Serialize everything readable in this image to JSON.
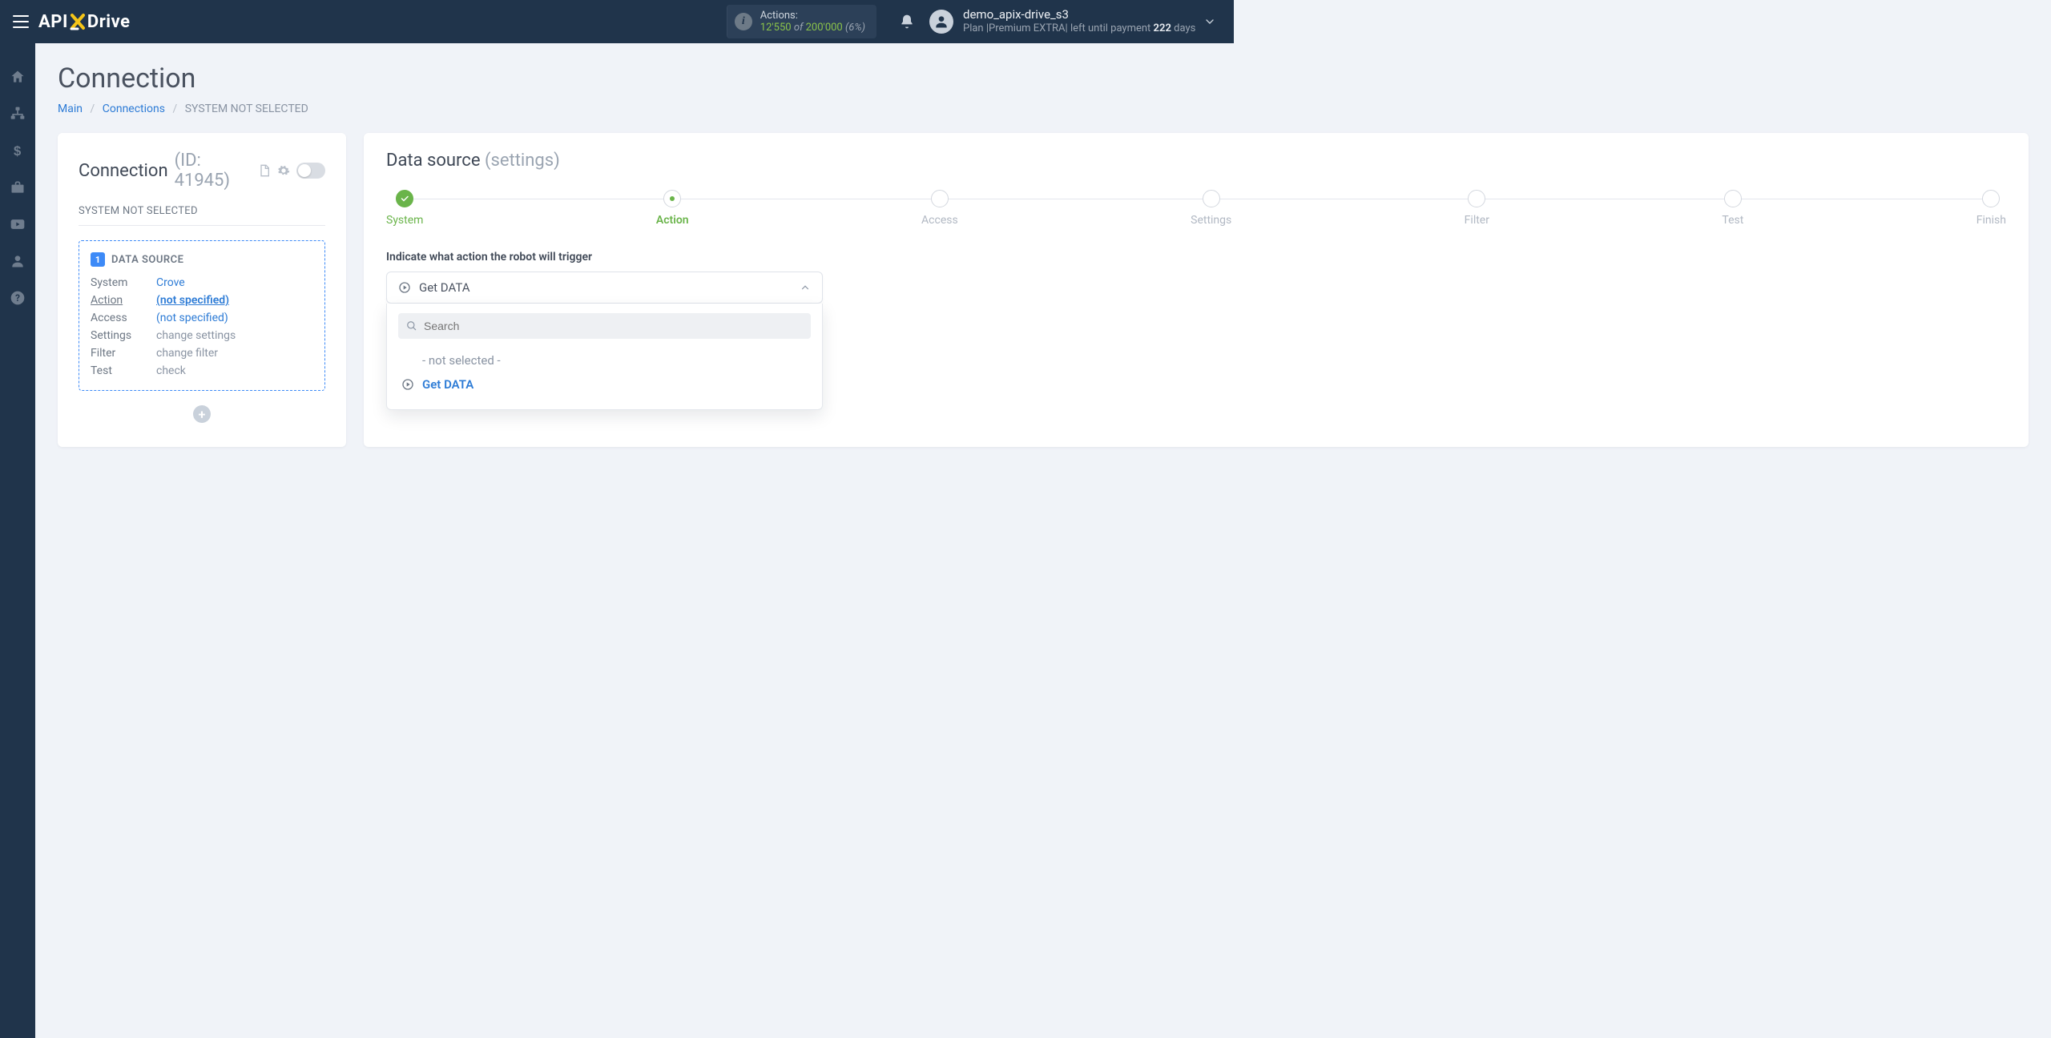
{
  "header": {
    "brand_api": "API",
    "brand_x": "X",
    "brand_drive": "Drive",
    "actions_label": "Actions:",
    "actions_count": "12'550",
    "actions_of": "of",
    "actions_total": "200'000",
    "actions_pct": "(6%)",
    "username": "demo_apix-drive_s3",
    "plan_prefix": "Plan |",
    "plan_name": "Premium EXTRA",
    "plan_suffix1": "| left until payment ",
    "plan_days": "222",
    "plan_suffix2": " days"
  },
  "page": {
    "title": "Connection",
    "breadcrumb": {
      "main": "Main",
      "connections": "Connections",
      "current": "SYSTEM NOT SELECTED"
    }
  },
  "left": {
    "title": "Connection",
    "id_label": "(ID: 41945)",
    "not_selected": "SYSTEM NOT SELECTED",
    "ds_badge": "1",
    "ds_label": "DATA SOURCE",
    "rows": {
      "system_k": "System",
      "system_v": "Crove",
      "action_k": "Action",
      "action_v": "(not specified)",
      "access_k": "Access",
      "access_v": "(not specified)",
      "settings_k": "Settings",
      "settings_v": "change settings",
      "filter_k": "Filter",
      "filter_v": "change filter",
      "test_k": "Test",
      "test_v": "check"
    }
  },
  "right": {
    "title": "Data source",
    "subtitle": "(settings)",
    "steps": [
      "System",
      "Action",
      "Access",
      "Settings",
      "Filter",
      "Test",
      "Finish"
    ],
    "field_label": "Indicate what action the robot will trigger",
    "selected": "Get DATA",
    "search_placeholder": "Search",
    "options": {
      "not_selected": "- not selected -",
      "get_data": "Get DATA"
    }
  }
}
